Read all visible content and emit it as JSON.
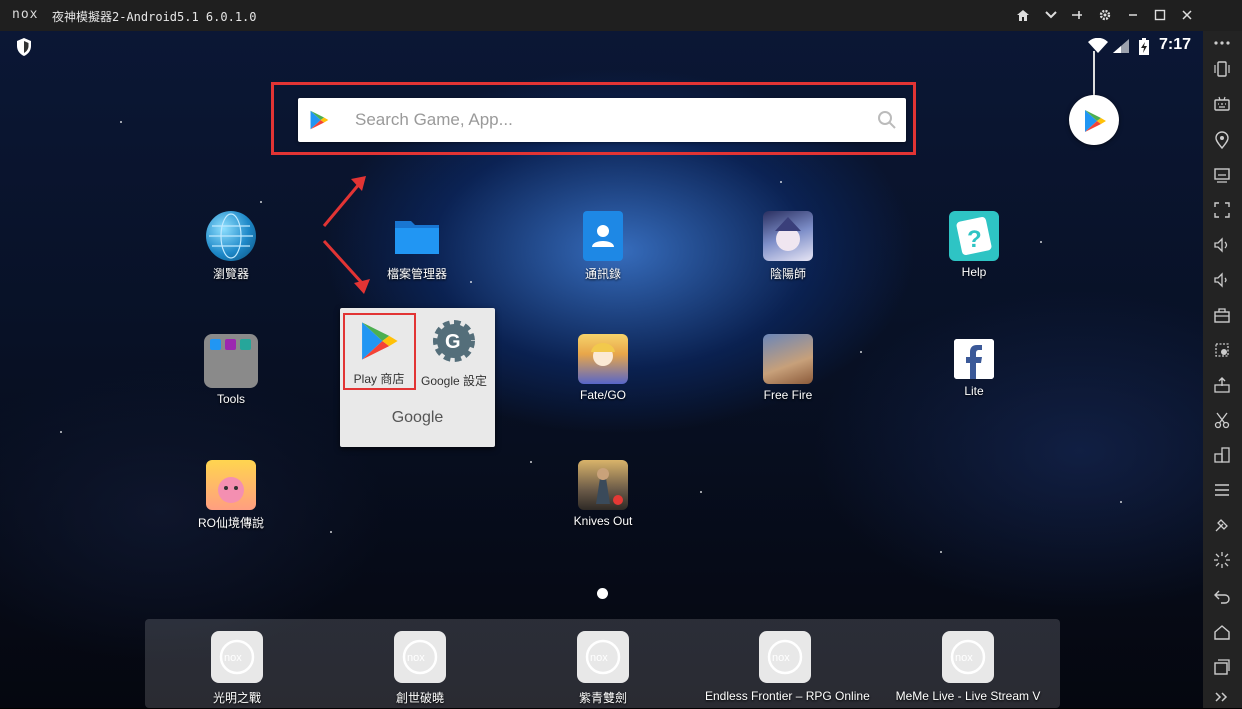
{
  "window": {
    "logo": "nox",
    "title": "夜神模擬器2-Android5.1 6.0.1.0"
  },
  "status": {
    "time": "7:17"
  },
  "search": {
    "placeholder": "Search Game, App..."
  },
  "apps": [
    {
      "label": "瀏覽器",
      "icon": "globe-icon"
    },
    {
      "label": "檔案管理器",
      "icon": "folder-icon"
    },
    {
      "label": "通訊錄",
      "icon": "contacts-icon"
    },
    {
      "label": "陰陽師",
      "icon": "game-onmyoji-icon"
    },
    {
      "label": "Help",
      "icon": "help-icon"
    },
    {
      "label": "Tools",
      "icon": "tools-folder-icon"
    },
    {
      "label": "Fate/GO",
      "icon": "game-fgo-icon"
    },
    {
      "label": "Free Fire",
      "icon": "game-freefire-icon"
    },
    {
      "label": "Lite",
      "icon": "facebook-icon"
    },
    {
      "label": "RO仙境傳說",
      "icon": "game-ro-icon"
    },
    {
      "label": "Knives Out",
      "icon": "game-knivesout-icon"
    }
  ],
  "folder": {
    "title": "Google",
    "items": [
      {
        "label": "Play 商店",
        "icon": "play-store-icon"
      },
      {
        "label": "Google 設定",
        "icon": "google-settings-icon"
      }
    ]
  },
  "dock": [
    {
      "label": "光明之戰"
    },
    {
      "label": "創世破曉"
    },
    {
      "label": "紫青雙劍"
    },
    {
      "label": "Endless Frontier – RPG Online"
    },
    {
      "label": "MeMe Live - Live Stream V"
    }
  ],
  "colors": {
    "highlight": "#e23434",
    "titlebar": "#1f1f1f",
    "sidebar": "#232323"
  }
}
